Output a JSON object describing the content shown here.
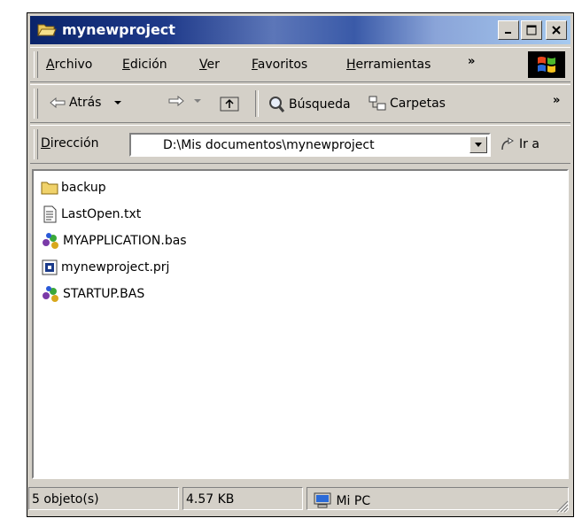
{
  "window": {
    "title": "mynewproject"
  },
  "menu": {
    "items": [
      {
        "label": "Archivo",
        "accel": "A",
        "rest": "rchivo"
      },
      {
        "label": "Edición",
        "accel": "E",
        "rest": "dición"
      },
      {
        "label": "Ver",
        "accel": "V",
        "rest": "er"
      },
      {
        "label": "Favoritos",
        "accel": "F",
        "rest": "avoritos"
      },
      {
        "label": "Herramientas",
        "accel": "H",
        "rest": "erramientas"
      }
    ],
    "overflow": "»"
  },
  "toolbar": {
    "back_label": "Atrás",
    "search_label": "Búsqueda",
    "folders_label": "Carpetas",
    "overflow": "»"
  },
  "address": {
    "label_accel": "D",
    "label_rest": "irección",
    "value": "D:\\Mis documentos\\mynewproject",
    "go_label": "Ir a"
  },
  "files": [
    {
      "name": "backup",
      "icon": "folder-icon"
    },
    {
      "name": "LastOpen.txt",
      "icon": "text-file-icon"
    },
    {
      "name": "MYAPPLICATION.bas",
      "icon": "basic-module-icon"
    },
    {
      "name": "mynewproject.prj",
      "icon": "project-file-icon"
    },
    {
      "name": "STARTUP.BAS",
      "icon": "basic-module-icon"
    }
  ],
  "status": {
    "count": "5 objeto(s)",
    "size": "4.57 KB",
    "location": "Mi PC"
  },
  "colors": {
    "title_start": "#0a246a",
    "title_end": "#a6caf0",
    "face": "#d4d0c8"
  }
}
